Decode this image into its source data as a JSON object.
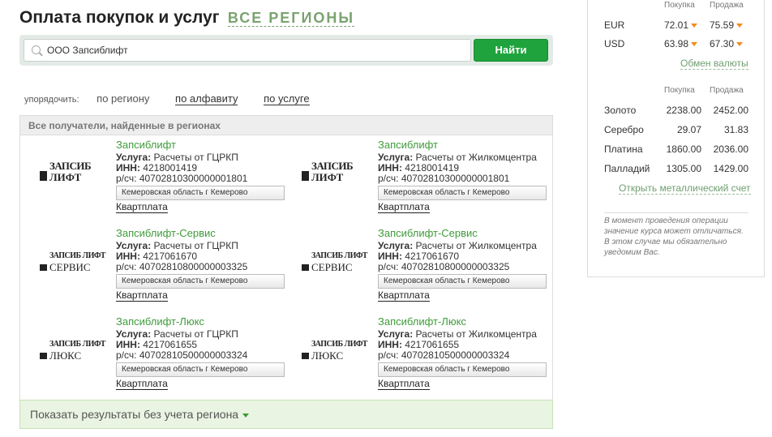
{
  "header": {
    "title": "Оплата покупок и услуг",
    "region_link": "ВСЕ РЕГИОНЫ"
  },
  "search": {
    "value": "ООО Запсиблифт",
    "button_label": "Найти"
  },
  "sort": {
    "label": "упорядочить:",
    "options": [
      "по региону",
      "по алфавиту",
      "по услуге"
    ]
  },
  "results": {
    "header": "Все получатели, найденные в регионах",
    "cards": [
      {
        "logo_line1": "ЗАПСИБ",
        "logo_line2": "ЛИФТ",
        "title": "Запсиблифт",
        "service_label": "Услуга:",
        "service": "Расчеты от ГЦРКП",
        "inn_label": "ИНН:",
        "inn": "4218001419",
        "account_label": "р/сч:",
        "account": "40702810300000001801",
        "region": "Кемеровская область г Кемерово",
        "link": "Квартплата"
      },
      {
        "logo_line1": "ЗАПСИБ",
        "logo_line2": "ЛИФТ",
        "title": "Запсиблифт",
        "service_label": "Услуга:",
        "service": "Расчеты от Жилкомцентра",
        "inn_label": "ИНН:",
        "inn": "4218001419",
        "account_label": "р/сч:",
        "account": "40702810300000001801",
        "region": "Кемеровская область г Кемерово",
        "link": "Квартплата"
      },
      {
        "logo_line1": "ЗАПСИБ ЛИФТ",
        "logo_line2": "СЕРВИС",
        "title": "Запсиблифт-Сервис",
        "service_label": "Услуга:",
        "service": "Расчеты от ГЦРКП",
        "inn_label": "ИНН:",
        "inn": "4217061670",
        "account_label": "р/сч:",
        "account": "40702810800000003325",
        "region": "Кемеровская область г Кемерово",
        "link": "Квартплата"
      },
      {
        "logo_line1": "ЗАПСИБ ЛИФТ",
        "logo_line2": "СЕРВИС",
        "title": "Запсиблифт-Сервис",
        "service_label": "Услуга:",
        "service": "Расчеты от Жилкомцентра",
        "inn_label": "ИНН:",
        "inn": "4217061670",
        "account_label": "р/сч:",
        "account": "40702810800000003325",
        "region": "Кемеровская область г Кемерово",
        "link": "Квартплата"
      },
      {
        "logo_line1": "ЗАПСИБ ЛИФТ",
        "logo_line2": "ЛЮКС",
        "title": "Запсиблифт-Люкс",
        "service_label": "Услуга:",
        "service": "Расчеты от ГЦРКП",
        "inn_label": "ИНН:",
        "inn": "4217061655",
        "account_label": "р/сч:",
        "account": "40702810500000003324",
        "region": "Кемеровская область г Кемерово",
        "link": "Квартплата"
      },
      {
        "logo_line1": "ЗАПСИБ ЛИФТ",
        "logo_line2": "ЛЮКС",
        "title": "Запсиблифт-Люкс",
        "service_label": "Услуга:",
        "service": "Расчеты от Жилкомцентра",
        "inn_label": "ИНН:",
        "inn": "4217061655",
        "account_label": "р/сч:",
        "account": "40702810500000003324",
        "region": "Кемеровская область г Кемерово",
        "link": "Квартплата"
      }
    ],
    "show_all": "Показать результаты без учета региона"
  },
  "sidebar": {
    "currency_header": {
      "buy": "Покупка",
      "sell": "Продажа"
    },
    "currencies": [
      {
        "code": "EUR",
        "buy": "72.01",
        "sell": "75.59"
      },
      {
        "code": "USD",
        "buy": "63.98",
        "sell": "67.30"
      }
    ],
    "exchange_link": "Обмен валюты",
    "metal_header": {
      "buy": "Покупка",
      "sell": "Продажа"
    },
    "metals": [
      {
        "name": "Золото",
        "buy": "2238.00",
        "sell": "2452.00"
      },
      {
        "name": "Серебро",
        "buy": "29.07",
        "sell": "31.83"
      },
      {
        "name": "Платина",
        "buy": "1860.00",
        "sell": "2036.00"
      },
      {
        "name": "Палладий",
        "buy": "1305.00",
        "sell": "1429.00"
      }
    ],
    "metal_account_link": "Открыть металлический счет",
    "note": "В момент проведения операции значение курса может отличаться. В этом случае мы обязательно уведомим Вас."
  },
  "colors": {
    "accent_green": "#1fa33c",
    "link_green": "#3e9b3a",
    "arrow_orange": "#f08c1e"
  }
}
